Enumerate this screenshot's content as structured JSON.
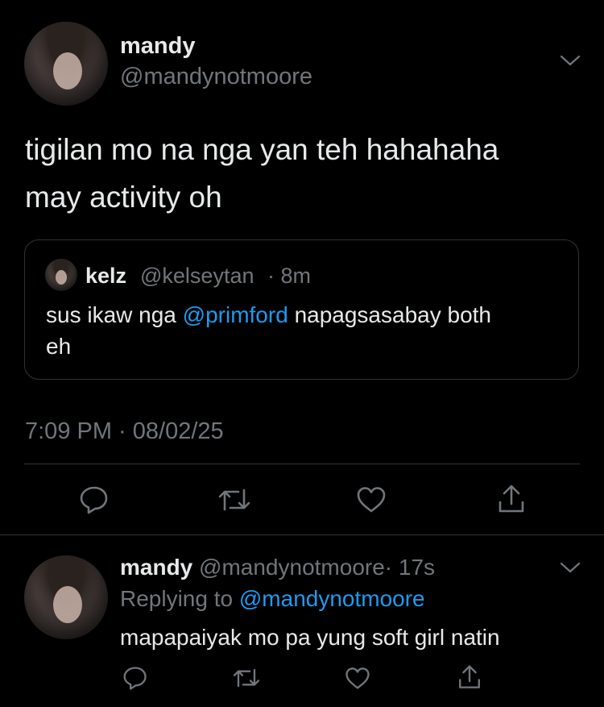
{
  "tweet": {
    "author_name": "mandy",
    "author_handle": "@mandynotmoore",
    "text_line1": "tigilan mo na nga yan teh hahahaha",
    "text_line2": "may activity oh",
    "timestamp": "7:09 PM · 08/02/25",
    "quote": {
      "author_name": "kelz",
      "author_handle": "@kelseytan",
      "time": "· 8m",
      "text_prefix": "sus ikaw nga",
      "mention": "@primford",
      "text_suffix": "napagsasabay both",
      "text_line2": "eh"
    },
    "actions": [
      "reply-icon",
      "retweet-icon",
      "like-icon",
      "share-icon"
    ]
  },
  "reply": {
    "author_name": "mandy",
    "author_handle": "@mandynotmoore",
    "time": "· 17s",
    "replying_to_label": "Replying to",
    "replying_to_handle": "@mandynotmoore",
    "text": "mapapaiyak mo pa yung soft girl natin",
    "actions": [
      "reply-icon",
      "retweet-icon",
      "like-icon",
      "share-icon"
    ]
  },
  "colors": {
    "background": "#000000",
    "text": "#e7e9ea",
    "muted": "#71767b",
    "link": "#1d9bf0",
    "divider": "#2f3336"
  }
}
